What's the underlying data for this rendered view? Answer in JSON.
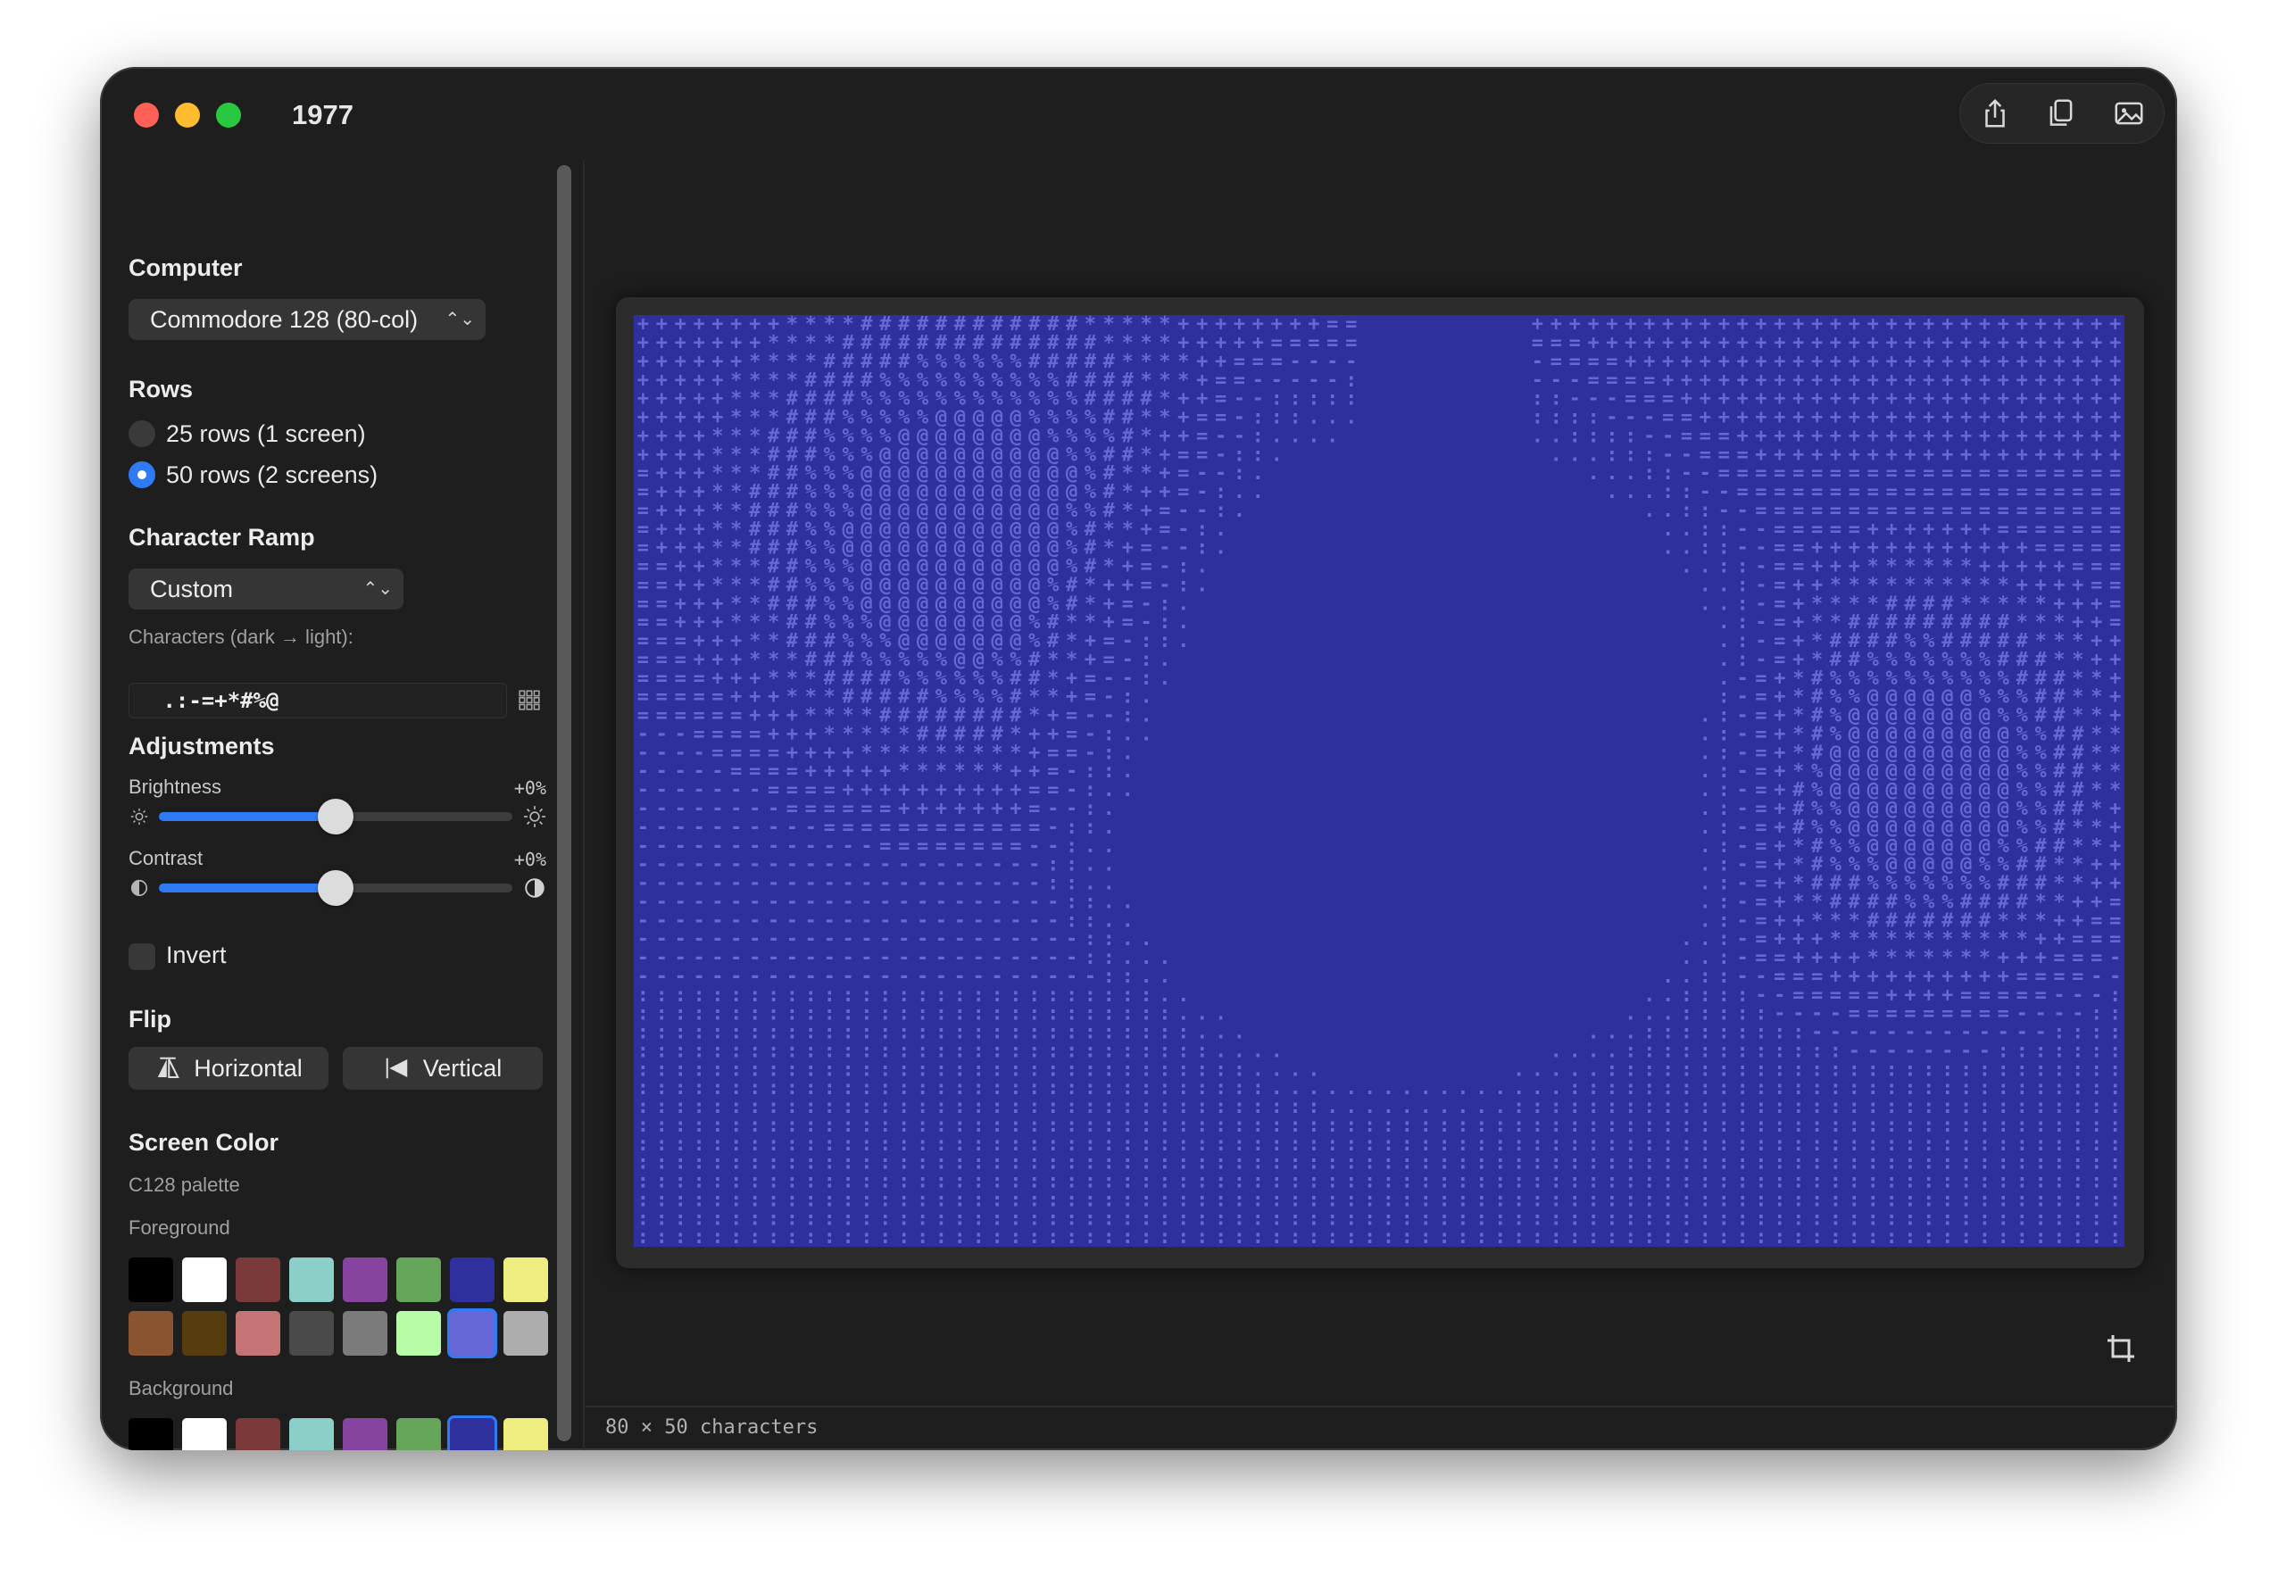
{
  "window": {
    "title": "1977",
    "toolbar": {
      "share_icon": "share-icon",
      "copy_icon": "copy-icon",
      "image_icon": "image-icon"
    }
  },
  "sidebar": {
    "computer": {
      "heading": "Computer",
      "selected": "Commodore 128 (80-col)"
    },
    "rows": {
      "heading": "Rows",
      "options": [
        {
          "label": "25 rows (1 screen)",
          "selected": false
        },
        {
          "label": "50 rows (2 screens)",
          "selected": true
        }
      ]
    },
    "ramp": {
      "heading": "Character Ramp",
      "selected": "Custom",
      "chars_label": "Characters (dark → light):",
      "chars_value": " .:-=+*#%@"
    },
    "adjustments": {
      "heading": "Adjustments",
      "brightness": {
        "label": "Brightness",
        "value_text": "+0%",
        "value": 0.5
      },
      "contrast": {
        "label": "Contrast",
        "value_text": "+0%",
        "value": 0.5
      },
      "invert": {
        "label": "Invert",
        "checked": false
      }
    },
    "flip": {
      "heading": "Flip",
      "horizontal": "Horizontal",
      "vertical": "Vertical"
    },
    "screen_color": {
      "heading": "Screen Color",
      "palette_name": "C128 palette",
      "foreground_label": "Foreground",
      "background_label": "Background",
      "palette": [
        "#000000",
        "#ffffff",
        "#7a3a3a",
        "#8ccfc9",
        "#8644a0",
        "#65a65a",
        "#2f2f9e",
        "#eeee80",
        "#8a5430",
        "#553d0d",
        "#c47475",
        "#4a4a4a",
        "#7b7b7b",
        "#b7fda8",
        "#6767d7",
        "#adadad"
      ],
      "foreground_selected": 14,
      "background_selected": 6
    }
  },
  "main": {
    "screen_bg": "#2f2f9e",
    "screen_fg": "#6767d7",
    "status": "80 × 50 characters"
  }
}
